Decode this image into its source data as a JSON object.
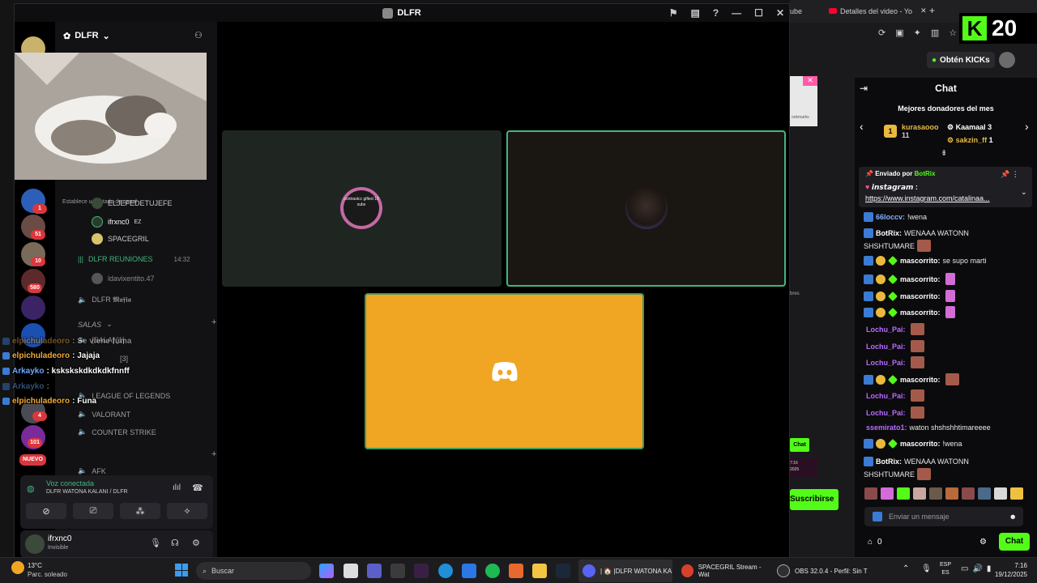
{
  "window": {
    "title": "DLFR"
  },
  "server": {
    "name": "DLFR"
  },
  "channels": {
    "status_hint": "Establece un estado de canal",
    "users_top": [
      "ELJEFEDETUJEFE",
      "ifrxnc0",
      "SPACEGRIL"
    ],
    "ez_badge": "EZ",
    "reuniones": {
      "name": "DLFR REUNIONES",
      "time": "14:32"
    },
    "reuniones_user": "ldavixentito.47",
    "mafia": "DLFR 𝕸𝖆𝖋𝖎𝖆",
    "salas": "SALAS",
    "sala1": "[SALA] [1]",
    "sala3": "[3]",
    "lol": "LEAGUE OF LEGENDS",
    "valorant": "VALORANT",
    "cs": "COUNTER STRIKE",
    "afk": "AFK"
  },
  "rail_badges": [
    "1",
    "51",
    "10",
    "580",
    "4",
    "101",
    "NUEVO"
  ],
  "voice": {
    "status": "Voz conectada",
    "channel": "DLFR WATONA KALANI / DLFR"
  },
  "user": {
    "name": "ifrxnc0",
    "status": "Invisible"
  },
  "overlay_chat": [
    {
      "name": "elpichuladeoro",
      "msg": ": Se viene fuma",
      "faded": true
    },
    {
      "name": "elpichuladeoro",
      "msg": ": Jajaja",
      "faded": false
    },
    {
      "name": "Arkayko",
      "msg": ": kskskskdkdkdkfnnff",
      "faded": false
    },
    {
      "name": "Arkayko",
      "msg": ":",
      "faded": true
    },
    {
      "name": "elpichuladeoro",
      "msg": ": Funa",
      "faded": false
    }
  ],
  "tiles": {
    "avatar1_text": "contrastcc gifted 10 subs"
  },
  "browser": {
    "tab1": "ube",
    "tab2": "Detalles del video - Yo",
    "kick_count": "20",
    "get_kicks": "Obtén KICKs",
    "chat_title": "Chat",
    "donors_title": "Mejores donadores del mes",
    "donors": [
      {
        "name": "kurasaooo",
        "amount": "11"
      },
      {
        "name": "Kaamaal",
        "amount": "3"
      },
      {
        "name": "sakzin_ff",
        "amount": "1"
      }
    ],
    "pinned_by": "Enviado por",
    "pinned_user": "BotRix",
    "pinned_title": "𝙞𝙣𝙨𝙩𝙖𝙜𝙧𝙖𝙢 :",
    "pinned_link": "https://www.instagram.com/catalinaa...",
    "subscribe": "Suscribirse",
    "chat_button_small": "Chat",
    "clock_small": "7:16",
    "year_small": "2025",
    "side_text": "bres",
    "bookmarks": "ookmarks",
    "send_placeholder": "Enviar un mensaje",
    "points": "0",
    "chat_button": "Chat"
  },
  "chat_messages": [
    {
      "name": "66loccv",
      "msg": "!wena",
      "style": "n"
    },
    {
      "name": "BotRix",
      "msg": "WENAAA WATONN",
      "style": "nw"
    },
    {
      "name": "",
      "msg": "SHSHTUMARE",
      "style": "cont"
    },
    {
      "name": "mascorrito",
      "msg": "se supo marti",
      "style": "nw"
    },
    {
      "name": "mascorrito",
      "msg": "",
      "style": "nw"
    },
    {
      "name": "mascorrito",
      "msg": "",
      "style": "nw"
    },
    {
      "name": "mascorrito",
      "msg": "",
      "style": "nw"
    },
    {
      "name": "Lochu_Pai",
      "msg": "",
      "style": "np"
    },
    {
      "name": "Lochu_Pai",
      "msg": "",
      "style": "np"
    },
    {
      "name": "Lochu_Pai",
      "msg": "",
      "style": "np"
    },
    {
      "name": "mascorrito",
      "msg": "",
      "style": "nw"
    },
    {
      "name": "Lochu_Pai",
      "msg": "",
      "style": "np"
    },
    {
      "name": "Lochu_Pai",
      "msg": "",
      "style": "np"
    },
    {
      "name": "ssemirato1",
      "msg": "waton shshshhtimareeee",
      "style": "np"
    },
    {
      "name": "mascorrito",
      "msg": "!wena",
      "style": "nw"
    },
    {
      "name": "BotRix",
      "msg": "WENAAA WATONN",
      "style": "nw"
    },
    {
      "name": "",
      "msg": "SHSHTUMARE",
      "style": "cont"
    }
  ],
  "taskbar": {
    "weather_temp": "13°C",
    "weather_desc": "Parc. soleado",
    "search": "Buscar",
    "app1": "| 🏠 |DLFR WATONA KA",
    "app2": "SPACEGRIL Stream - Wat",
    "app3": "OBS 32.0.4 - Perfil: Sin T",
    "lang1": "ESP",
    "lang2": "ES",
    "time": "7:16",
    "date": "19/12/2025"
  },
  "colors": {
    "kick_green": "#53fc18",
    "discord_blurple": "#5865f2",
    "tile_yellow": "#f0a623",
    "speaking_green": "#43b581"
  }
}
